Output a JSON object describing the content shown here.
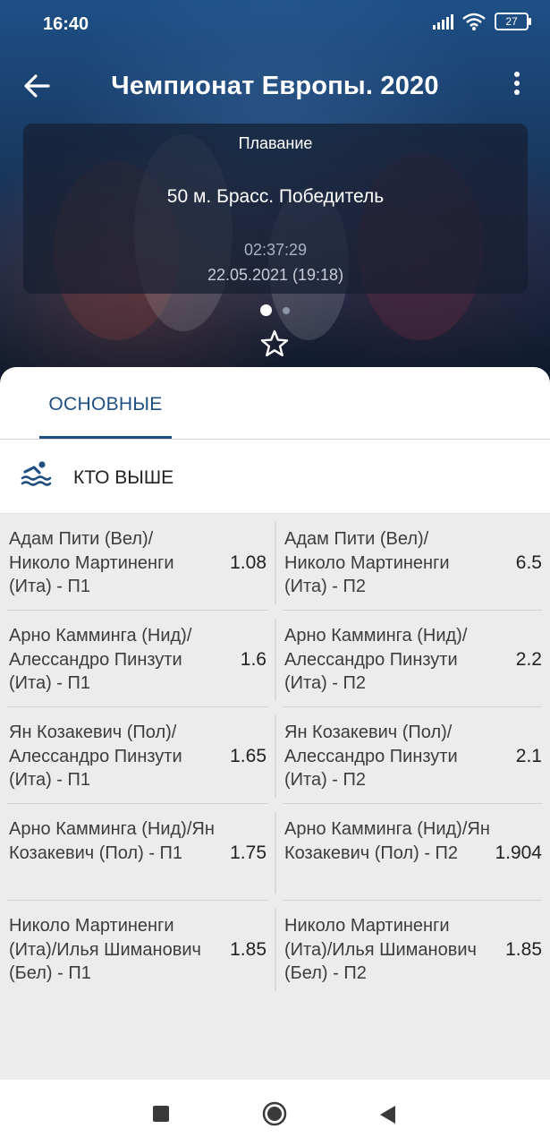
{
  "status": {
    "time": "16:40",
    "battery": "27"
  },
  "header": {
    "title": "Чемпионат Европы. 2020"
  },
  "card": {
    "sport": "Плавание",
    "event": "50 м. Брасс. Победитель",
    "timer": "02:37:29",
    "date": "22.05.2021 (19:18)"
  },
  "tabs": [
    {
      "label": "ОСНОВНЫЕ",
      "active": true
    }
  ],
  "market": {
    "title": "КТО ВЫШЕ",
    "icon": "swimmer-icon"
  },
  "rows": [
    {
      "left": {
        "name": "Адам Пити (Вел)/ Николо Мартиненги (Ита) - П1",
        "odd": "1.08"
      },
      "right": {
        "name": "Адам Пити (Вел)/ Николо Мартиненги (Ита) - П2",
        "odd": "6.5"
      }
    },
    {
      "left": {
        "name": "Арно Камминга (Нид)/ Алессандро Пинзути (Ита) - П1",
        "odd": "1.6"
      },
      "right": {
        "name": "Арно Камминга (Нид)/ Алессандро Пинзути (Ита) - П2",
        "odd": "2.2"
      }
    },
    {
      "left": {
        "name": "Ян Козакевич (Пол)/ Алессандро Пинзути (Ита) - П1",
        "odd": "1.65"
      },
      "right": {
        "name": "Ян Козакевич (Пол)/ Алессандро Пинзути (Ита) - П2",
        "odd": "2.1"
      }
    },
    {
      "left": {
        "name": "Арно Камминга (Нид)/Ян Козакевич (Пол) - П1",
        "odd": "1.75"
      },
      "right": {
        "name": "Арно Камминга (Нид)/Ян Козакевич (Пол) - П2",
        "odd": "1.904"
      }
    },
    {
      "left": {
        "name": "Николо Мартиненги (Ита)/Илья Шиманович (Бел) - П1",
        "odd": "1.85"
      },
      "right": {
        "name": "Николо Мартиненги (Ита)/Илья Шиманович (Бел) - П2",
        "odd": "1.85"
      }
    }
  ],
  "colors": {
    "accent": "#1f4f82",
    "header_bg": "#1a3f6b",
    "list_bg": "#ececec"
  }
}
